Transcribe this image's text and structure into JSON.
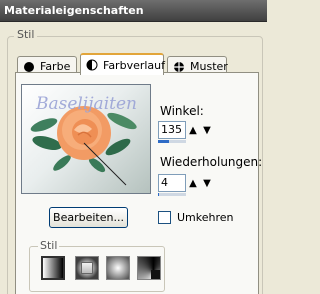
{
  "window": {
    "title": "Materialeigenschaften"
  },
  "stil": {
    "legend": "Stil",
    "tabs": [
      {
        "label": "Farbe",
        "icon": "filled-circle-icon"
      },
      {
        "label": "Farbverlauf",
        "icon": "half-circle-gradient-icon"
      },
      {
        "label": "Muster",
        "icon": "pattern-ball-icon"
      }
    ],
    "active_tab": "Farbverlauf"
  },
  "gradient": {
    "preview_text": "Baselijaiten",
    "winkel_label": "Winkel:",
    "winkel_value": "135",
    "winkel_fraction": 0.375,
    "wiederholungen_label": "Wiederholungen:",
    "wiederholungen_value": "4",
    "wiederholungen_fraction": 0.04,
    "edit_button": "Bearbeiten...",
    "invert_label": "Umkehren",
    "invert_checked": false,
    "style_legend": "Stil",
    "style_options": [
      "linear",
      "rectangular",
      "sunburst",
      "radial"
    ],
    "selected_style": "linear"
  },
  "colors": {
    "accent": "#2e6bc6",
    "titlebar": "#505050",
    "tab_highlight": "#e2a53a"
  }
}
